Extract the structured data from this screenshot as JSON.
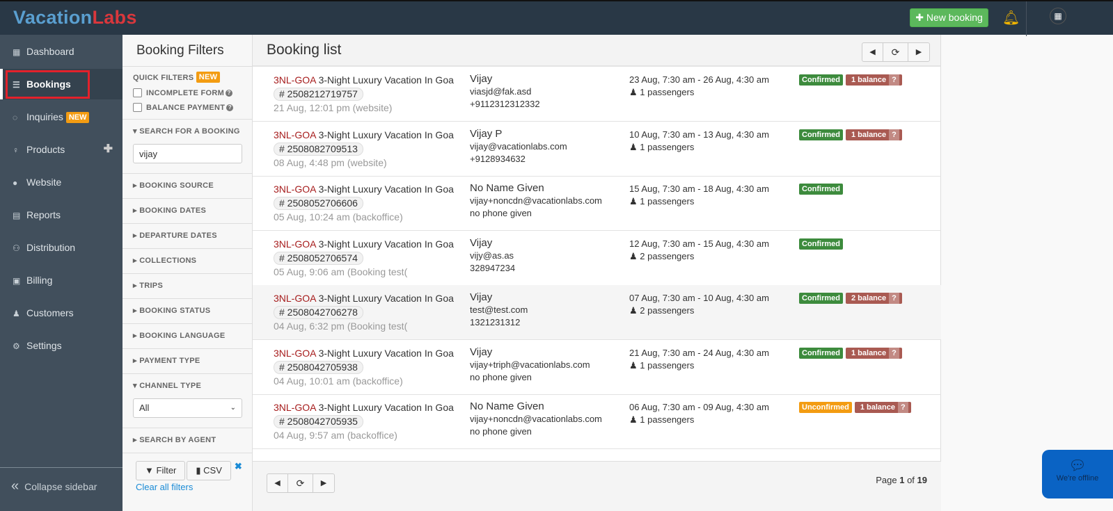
{
  "topbar": {
    "logo_a": "Vacation",
    "logo_b": "Labs",
    "new_booking": "New booking"
  },
  "sidebar": {
    "items": [
      {
        "label": "Dashboard",
        "icon": "calendar-icon"
      },
      {
        "label": "Bookings",
        "icon": "list-icon",
        "active": true
      },
      {
        "label": "Inquiries",
        "icon": "comment-icon",
        "badge": "NEW"
      },
      {
        "label": "Products",
        "icon": "lightbulb-icon"
      },
      {
        "label": "Website",
        "icon": "globe-icon"
      },
      {
        "label": "Reports",
        "icon": "report-icon"
      },
      {
        "label": "Distribution",
        "icon": "users-icon"
      },
      {
        "label": "Billing",
        "icon": "money-icon"
      },
      {
        "label": "Customers",
        "icon": "user-icon"
      },
      {
        "label": "Settings",
        "icon": "gear-icon"
      }
    ],
    "collapse": "Collapse sidebar"
  },
  "filters": {
    "title": "Booking Filters",
    "quick": "QUICK FILTERS",
    "new": "NEW",
    "incomplete": "INCOMPLETE FORM",
    "balance": "BALANCE PAYMENT",
    "search_label": "SEARCH FOR A BOOKING",
    "search_value": "vijay",
    "sections": [
      "BOOKING SOURCE",
      "BOOKING DATES",
      "DEPARTURE DATES",
      "COLLECTIONS",
      "TRIPS",
      "BOOKING STATUS",
      "BOOKING LANGUAGE",
      "PAYMENT TYPE"
    ],
    "channel_label": "CHANNEL TYPE",
    "channel_value": "All",
    "agent": "SEARCH BY AGENT",
    "filter_btn": "Filter",
    "csv_btn": "CSV",
    "clear": "Clear all filters"
  },
  "main": {
    "title": "Booking list",
    "page_pre": "Page ",
    "page_cur": "1",
    "page_mid": " of ",
    "page_total": "19"
  },
  "bookings": [
    {
      "code": "3NL-GOA",
      "name": "3-Night Luxury Vacation In Goa",
      "id": "# 2508212719757",
      "meta": "21 Aug, 12:01 pm (website)",
      "customer": "Vijay",
      "email": "viasjd@fak.asd",
      "phone": "+9112312312332",
      "dates": "23 Aug, 7:30 am - 26 Aug, 4:30 am",
      "pax": "1 passengers",
      "status": "Confirmed",
      "balance": "1 balance"
    },
    {
      "code": "3NL-GOA",
      "name": "3-Night Luxury Vacation In Goa",
      "id": "# 2508082709513",
      "meta": "08 Aug, 4:48 pm (website)",
      "customer": "Vijay P",
      "email": "vijay@vacationlabs.com",
      "phone": "+9128934632",
      "dates": "10 Aug, 7:30 am - 13 Aug, 4:30 am",
      "pax": "1 passengers",
      "status": "Confirmed",
      "balance": "1 balance"
    },
    {
      "code": "3NL-GOA",
      "name": "3-Night Luxury Vacation In Goa",
      "id": "# 2508052706606",
      "meta": "05 Aug, 10:24 am (backoffice)",
      "customer": "No Name Given",
      "email": "vijay+noncdn@vacationlabs.com",
      "phone": "no phone given",
      "dates": "15 Aug, 7:30 am - 18 Aug, 4:30 am",
      "pax": "1 passengers",
      "status": "Confirmed"
    },
    {
      "code": "3NL-GOA",
      "name": "3-Night Luxury Vacation In Goa",
      "id": "# 2508052706574",
      "meta": "05 Aug, 9:06 am (Booking test(",
      "customer": "Vijay",
      "email": "vijy@as.as",
      "phone": "328947234",
      "dates": "12 Aug, 7:30 am - 15 Aug, 4:30 am",
      "pax": "2 passengers",
      "status": "Confirmed"
    },
    {
      "code": "3NL-GOA",
      "name": "3-Night Luxury Vacation In Goa",
      "id": "# 2508042706278",
      "meta": "04 Aug, 6:32 pm (Booking test(",
      "customer": "Vijay",
      "email": "test@test.com",
      "phone": "1321231312",
      "dates": "07 Aug, 7:30 am - 10 Aug, 4:30 am",
      "pax": "2 passengers",
      "status": "Confirmed",
      "balance": "2 balance"
    },
    {
      "code": "3NL-GOA",
      "name": "3-Night Luxury Vacation In Goa",
      "id": "# 2508042705938",
      "meta": "04 Aug, 10:01 am (backoffice)",
      "customer": "Vijay",
      "email": "vijay+triph@vacationlabs.com",
      "phone": "no phone given",
      "dates": "21 Aug, 7:30 am - 24 Aug, 4:30 am",
      "pax": "1 passengers",
      "status": "Confirmed",
      "balance": "1 balance"
    },
    {
      "code": "3NL-GOA",
      "name": "3-Night Luxury Vacation In Goa",
      "id": "# 2508042705935",
      "meta": "04 Aug, 9:57 am (backoffice)",
      "customer": "No Name Given",
      "email": "vijay+noncdn@vacationlabs.com",
      "phone": "no phone given",
      "dates": "06 Aug, 7:30 am - 09 Aug, 4:30 am",
      "pax": "1 passengers",
      "status": "Unconfirmed",
      "balance": "1 balance"
    }
  ],
  "chat": {
    "label": "We're offline"
  },
  "colors": {
    "topbar": "#293846",
    "sidebar": "#414f5c",
    "confirmed": "#3d8b3d",
    "unconfirmed": "#f39c12",
    "balance": "#a95a52",
    "primary": "#5cb85c"
  }
}
